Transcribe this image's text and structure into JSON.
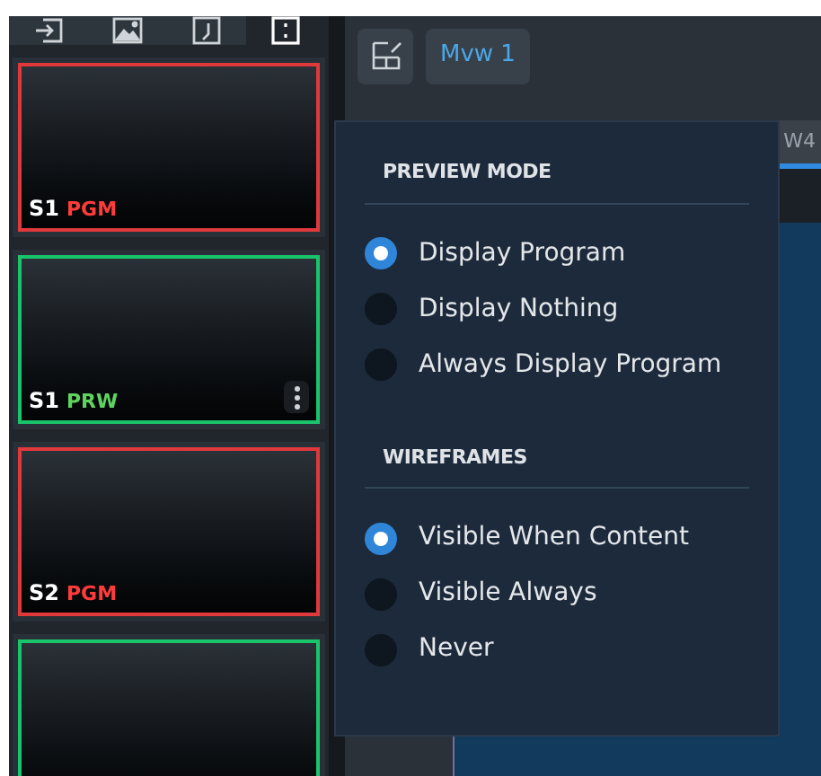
{
  "sidebar": {
    "tabs": [
      {
        "selected": false
      },
      {
        "selected": false
      },
      {
        "selected": false
      },
      {
        "selected": true
      }
    ],
    "tiles": [
      {
        "source": "S1",
        "tag": "PGM",
        "kind": "pgm",
        "menu": false
      },
      {
        "source": "S1",
        "tag": "PRW",
        "kind": "prw",
        "menu": true
      },
      {
        "source": "S2",
        "tag": "PGM",
        "kind": "pgm",
        "menu": false
      },
      {
        "kind": "prw",
        "menu": false
      }
    ]
  },
  "toolbar": {
    "tab": "Mvw 1"
  },
  "content": {
    "tab": "W4"
  },
  "menu": {
    "sections": [
      {
        "title": "PREVIEW MODE",
        "options": [
          {
            "label": "Display Program",
            "selected": true
          },
          {
            "label": "Display Nothing",
            "selected": false
          },
          {
            "label": "Always Display Program",
            "selected": false
          }
        ]
      },
      {
        "title": "WIREFRAMES",
        "options": [
          {
            "label": "Visible When Content",
            "selected": true
          },
          {
            "label": "Visible Always",
            "selected": false
          },
          {
            "label": "Never",
            "selected": false
          }
        ]
      }
    ]
  }
}
